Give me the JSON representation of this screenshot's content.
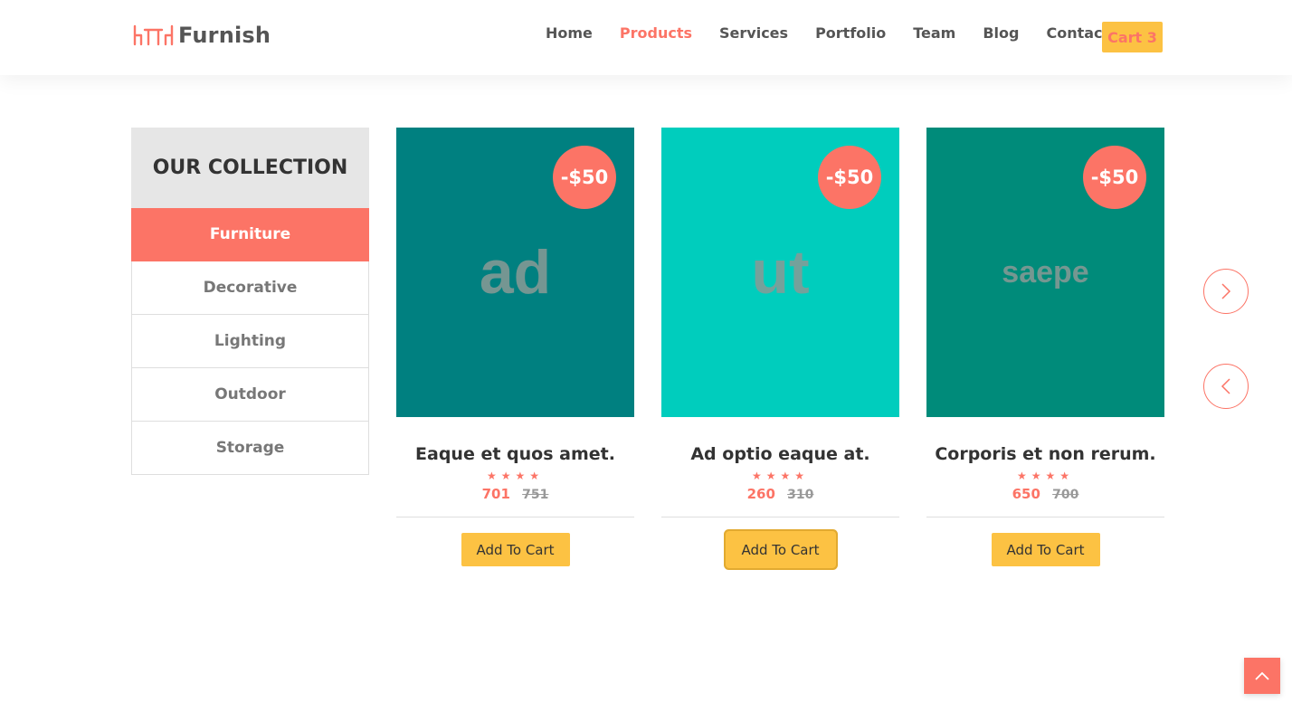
{
  "header": {
    "logo_text": "Furnish",
    "logo_icon": "table-chairs-icon",
    "nav": [
      {
        "label": "Home",
        "active": false
      },
      {
        "label": "Products",
        "active": true
      },
      {
        "label": "Services",
        "active": false
      },
      {
        "label": "Portfolio",
        "active": false
      },
      {
        "label": "Team",
        "active": false
      },
      {
        "label": "Blog",
        "active": false
      },
      {
        "label": "Contact",
        "active": false
      }
    ],
    "cart_label": "Cart 3"
  },
  "sidebar": {
    "title": "OUR COLLECTION",
    "categories": [
      {
        "label": "Furniture",
        "active": true
      },
      {
        "label": "Decorative",
        "active": false
      },
      {
        "label": "Lighting",
        "active": false
      },
      {
        "label": "Outdoor",
        "active": false
      },
      {
        "label": "Storage",
        "active": false
      }
    ]
  },
  "products": [
    {
      "image_text": "ad",
      "image_bg": "#008080",
      "discount": "-$50",
      "title": "Eaque et quos amet.",
      "rating": "★★★★",
      "price": "701",
      "old_price": "751",
      "button_label": "Add To Cart"
    },
    {
      "image_text": "ut",
      "image_bg": "#00cdbd",
      "discount": "-$50",
      "title": "Ad optio eaque at.",
      "rating": "★★★★",
      "price": "260",
      "old_price": "310",
      "button_label": "Add To Cart"
    },
    {
      "image_text": "saepe",
      "image_bg": "#008b7a",
      "discount": "-$50",
      "title": "Corporis et non rerum.",
      "rating": "★★★★",
      "price": "650",
      "old_price": "700",
      "button_label": "Add To Cart"
    }
  ],
  "colors": {
    "accent": "#fc7466",
    "cart_yellow": "#fcc243",
    "sidebar_header_bg": "#e6e6e6"
  },
  "icons": {
    "next": "chevron-right-icon",
    "prev": "chevron-left-icon",
    "scroll_top": "chevron-up-icon"
  }
}
